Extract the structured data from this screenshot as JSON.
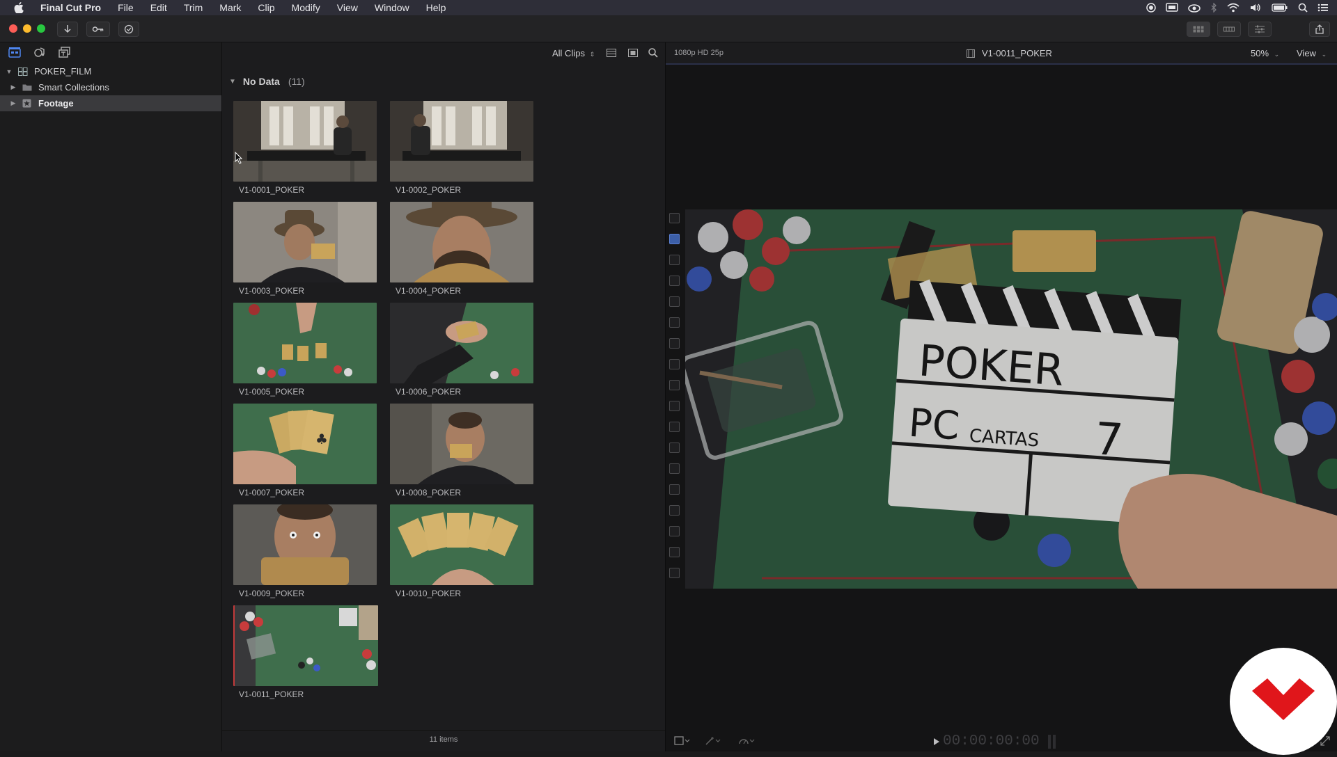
{
  "menubar": {
    "app_name": "Final Cut Pro",
    "items": [
      "File",
      "Edit",
      "Trim",
      "Mark",
      "Clip",
      "Modify",
      "View",
      "Window",
      "Help"
    ]
  },
  "sidebar": {
    "library": "POKER_FILM",
    "items": [
      {
        "label": "Smart Collections",
        "icon": "folder-icon"
      },
      {
        "label": "Footage",
        "icon": "star-event-icon"
      }
    ]
  },
  "browser": {
    "filter_label": "All Clips",
    "group_label": "No Data",
    "group_count": "(11)",
    "clips": [
      "V1-0001_POKER",
      "V1-0002_POKER",
      "V1-0003_POKER",
      "V1-0004_POKER",
      "V1-0005_POKER",
      "V1-0006_POKER",
      "V1-0007_POKER",
      "V1-0008_POKER",
      "V1-0009_POKER",
      "V1-0010_POKER",
      "V1-0011_POKER"
    ],
    "item_count": "11 items"
  },
  "viewer": {
    "format": "1080p HD 25p",
    "clip_name": "V1-0011_POKER",
    "zoom": "50%",
    "view_label": "View",
    "timecode": "00:00:00:00",
    "slate": {
      "title": "POKER",
      "line2": "PC",
      "line2b": "CARTAS",
      "take": "7"
    }
  },
  "colors": {
    "menubar": "#2e2e38",
    "accent": "#3b6fe0",
    "logo_red": "#e0161b"
  }
}
